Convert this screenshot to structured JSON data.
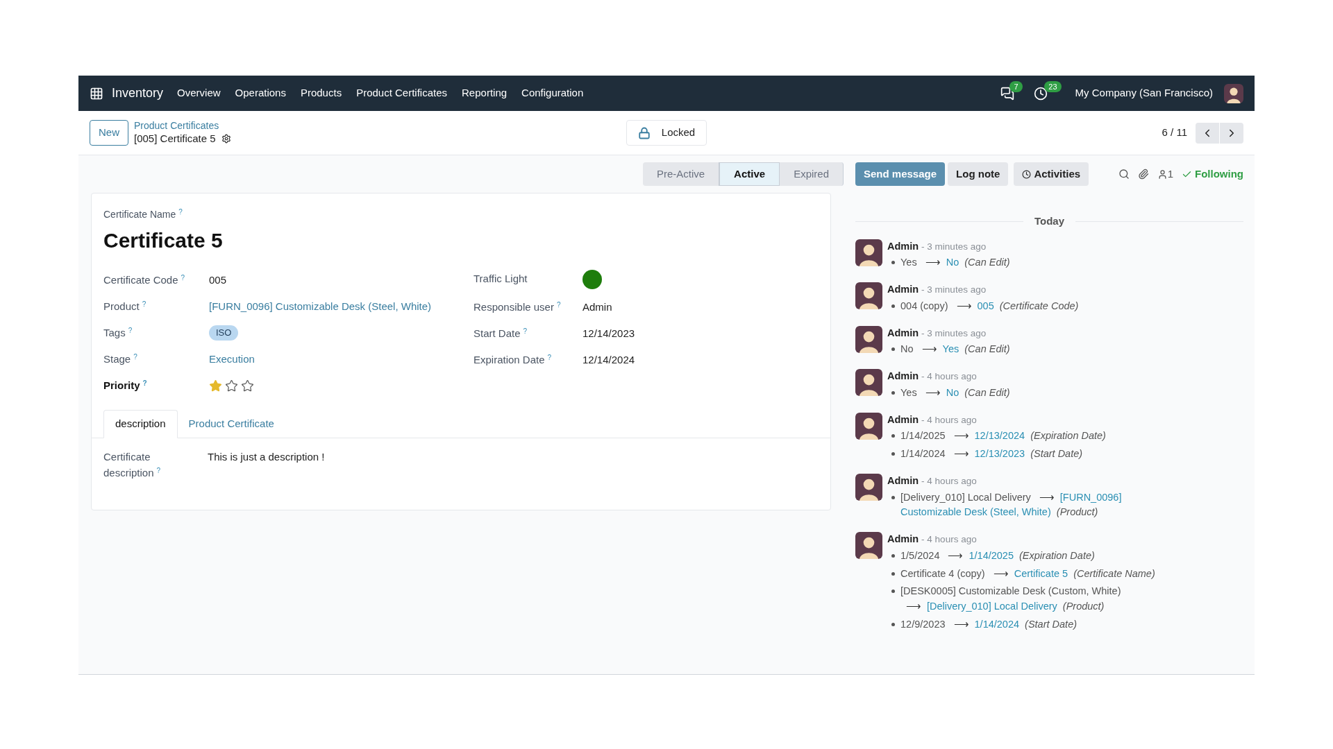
{
  "navbar": {
    "app": "Inventory",
    "menu": [
      "Overview",
      "Operations",
      "Products",
      "Product Certificates",
      "Reporting",
      "Configuration"
    ],
    "messages_count": "7",
    "activities_count": "23",
    "company": "My Company (San Francisco)"
  },
  "control_panel": {
    "new_button": "New",
    "breadcrumb_parent": "Product Certificates",
    "breadcrumb_current": "[005] Certificate 5",
    "lock_button": "Locked",
    "pager": "6 / 11"
  },
  "status_bar": [
    {
      "label": "Pre-Active",
      "selected": false
    },
    {
      "label": "Active",
      "selected": true
    },
    {
      "label": "Expired",
      "selected": false
    }
  ],
  "form": {
    "name_label": "Certificate Name",
    "name_help": "?",
    "name": "Certificate 5",
    "left_fields": [
      {
        "kind": "text",
        "label": "Certificate Code",
        "help": "?",
        "value": "005"
      },
      {
        "kind": "link",
        "label": "Product",
        "help": "?",
        "value": "[FURN_0096] Customizable Desk (Steel, White)"
      },
      {
        "kind": "tag",
        "label": "Tags",
        "help": "?",
        "value": "ISO"
      },
      {
        "kind": "link",
        "label": "Stage",
        "help": "?",
        "value": "Execution"
      },
      {
        "kind": "stars",
        "label": "Priority",
        "help": "?",
        "stars": 1
      }
    ],
    "right_fields": [
      {
        "kind": "light",
        "label": "Traffic Light",
        "color": "#1e7d0c"
      },
      {
        "kind": "text",
        "label": "Responsible user",
        "help": "?",
        "value": "Admin"
      },
      {
        "kind": "text",
        "label": "Start Date",
        "help": "?",
        "value": "12/14/2023"
      },
      {
        "kind": "text",
        "label": "Expiration Date",
        "help": "?",
        "value": "12/14/2024"
      }
    ],
    "tabs": [
      {
        "label": "description",
        "selected": true
      },
      {
        "label": "Product Certificate",
        "selected": false
      }
    ],
    "description_label": "Certificate description",
    "description_help": "?",
    "description": "This is just a description !"
  },
  "chatter": {
    "send_message": "Send message",
    "log_note": "Log note",
    "activities": "Activities",
    "followers_count": "1",
    "following": "Following",
    "day": "Today",
    "messages": [
      {
        "author": "Admin",
        "time": "- 3 minutes ago",
        "changes": [
          {
            "old": "Yes",
            "arrow": "⟶",
            "new": "No",
            "field": "(Can Edit)"
          }
        ]
      },
      {
        "author": "Admin",
        "time": "- 3 minutes ago",
        "changes": [
          {
            "old": "004 (copy)",
            "arrow": "⟶",
            "new": "005",
            "field": "(Certificate Code)"
          }
        ]
      },
      {
        "author": "Admin",
        "time": "- 3 minutes ago",
        "changes": [
          {
            "old": "No",
            "arrow": "⟶",
            "new": "Yes",
            "field": "(Can Edit)"
          }
        ]
      },
      {
        "author": "Admin",
        "time": "- 4 hours ago",
        "changes": [
          {
            "old": "Yes",
            "arrow": "⟶",
            "new": "No",
            "field": "(Can Edit)"
          }
        ]
      },
      {
        "author": "Admin",
        "time": "- 4 hours ago",
        "changes": [
          {
            "old": "1/14/2025",
            "arrow": "⟶",
            "new": "12/13/2024",
            "field": "(Expiration Date)"
          },
          {
            "old": "1/14/2024",
            "arrow": "⟶",
            "new": "12/13/2023",
            "field": "(Start Date)"
          }
        ]
      },
      {
        "author": "Admin",
        "time": "- 4 hours ago",
        "changes": [
          {
            "old": "[Delivery_010] Local Delivery",
            "arrow": "⟶",
            "new": "[FURN_0096] Customizable Desk (Steel, White)",
            "field": "(Product)"
          }
        ]
      },
      {
        "author": "Admin",
        "time": "- 4 hours ago",
        "changes": [
          {
            "old": "1/5/2024",
            "arrow": "⟶",
            "new": "1/14/2025",
            "field": "(Expiration Date)"
          },
          {
            "old": "Certificate 4 (copy)",
            "arrow": "⟶",
            "new": "Certificate 5",
            "field": "(Certificate Name)"
          },
          {
            "old": "[DESK0005] Customizable Desk (Custom, White)",
            "arrow": "⟶",
            "new": "[Delivery_010] Local Delivery",
            "field": "(Product)"
          },
          {
            "old": "12/9/2023",
            "arrow": "⟶",
            "new": "1/14/2024",
            "field": "(Start Date)"
          }
        ]
      }
    ]
  }
}
